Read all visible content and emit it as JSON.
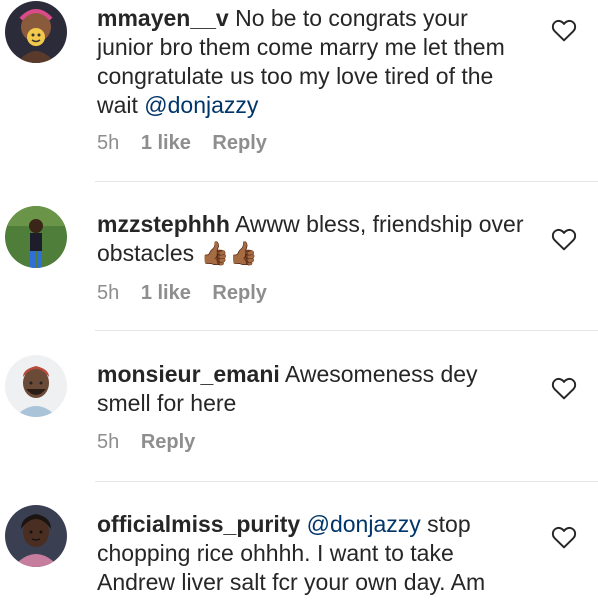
{
  "comments": [
    {
      "username": "mmayen__v",
      "text_before": " No be to congrats your junior bro them come marry me let them congratulate us too my love tired of the wait ",
      "mention": "@donjazzy",
      "text_after": "",
      "time": "5h",
      "likes": "1 like",
      "reply": "Reply"
    },
    {
      "username": "mzzstephhh",
      "text_before": " Awww bless, friendship over obstacles ",
      "mention": "",
      "text_after": "",
      "emoji": "👍🏾👍🏾",
      "time": "5h",
      "likes": "1 like",
      "reply": "Reply"
    },
    {
      "username": "monsieur_emani",
      "text_before": " Awesomeness dey smell for here",
      "mention": "",
      "text_after": "",
      "time": "5h",
      "reply": "Reply"
    },
    {
      "username": "officialmiss_purity",
      "text_before": " ",
      "mention": "@donjazzy",
      "text_after": " stop chopping rice ohhhh. I want to take Andrew liver salt fcr your own day. Am",
      "time": "",
      "reply": ""
    }
  ],
  "icons": {
    "like": "heart-outline-icon"
  },
  "colors": {
    "text": "#262626",
    "meta": "#8e8e8e",
    "mention": "#003569"
  }
}
